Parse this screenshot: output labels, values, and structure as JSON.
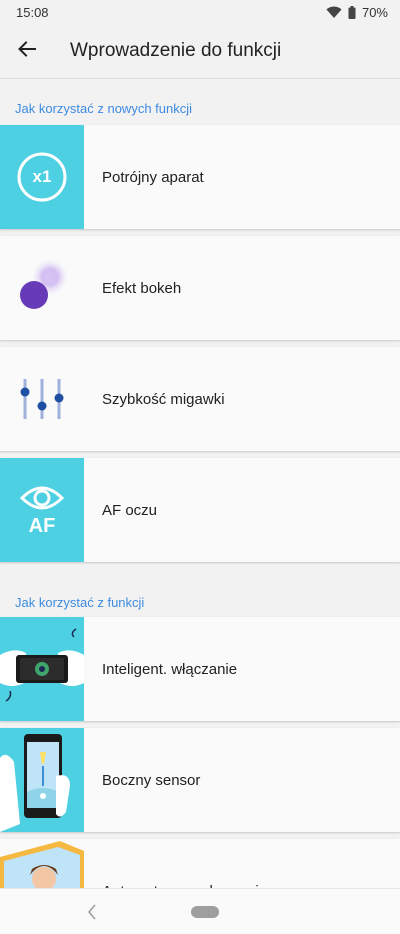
{
  "status_bar": {
    "time": "15:08",
    "battery": "70%",
    "icons": [
      "wifi-icon",
      "battery-icon"
    ]
  },
  "header": {
    "title": "Wprowadzenie do funkcji",
    "back_icon": "arrow-back-icon"
  },
  "sections": [
    {
      "title": "Jak korzystać z nowych funkcji",
      "items": [
        {
          "label": "Potrójny aparat",
          "icon": "x1-zoom-icon",
          "badge": "x1"
        },
        {
          "label": "Efekt bokeh",
          "icon": "bokeh-icon"
        },
        {
          "label": "Szybkość migawki",
          "icon": "sliders-icon"
        },
        {
          "label": "AF oczu",
          "icon": "eye-af-icon",
          "badge": "AF"
        }
      ]
    },
    {
      "title": "Jak korzystać z funkcji",
      "items": [
        {
          "label": "Inteligent. włączanie",
          "icon": "hands-phone-landscape-icon"
        },
        {
          "label": "Boczny sensor",
          "icon": "hand-phone-portrait-icon"
        },
        {
          "label": "Automatyczne obracanie",
          "icon": "auto-rotate-illustration-icon"
        }
      ]
    }
  ],
  "nav_bar": {
    "back_icon": "nav-back-icon",
    "home_icon": "nav-home-pill-icon"
  },
  "colors": {
    "accent": "#3d8be0",
    "teal": "#4dd0e1",
    "bokeh_purple": "#673ab7",
    "slider_blue": "#1e4fa3"
  }
}
